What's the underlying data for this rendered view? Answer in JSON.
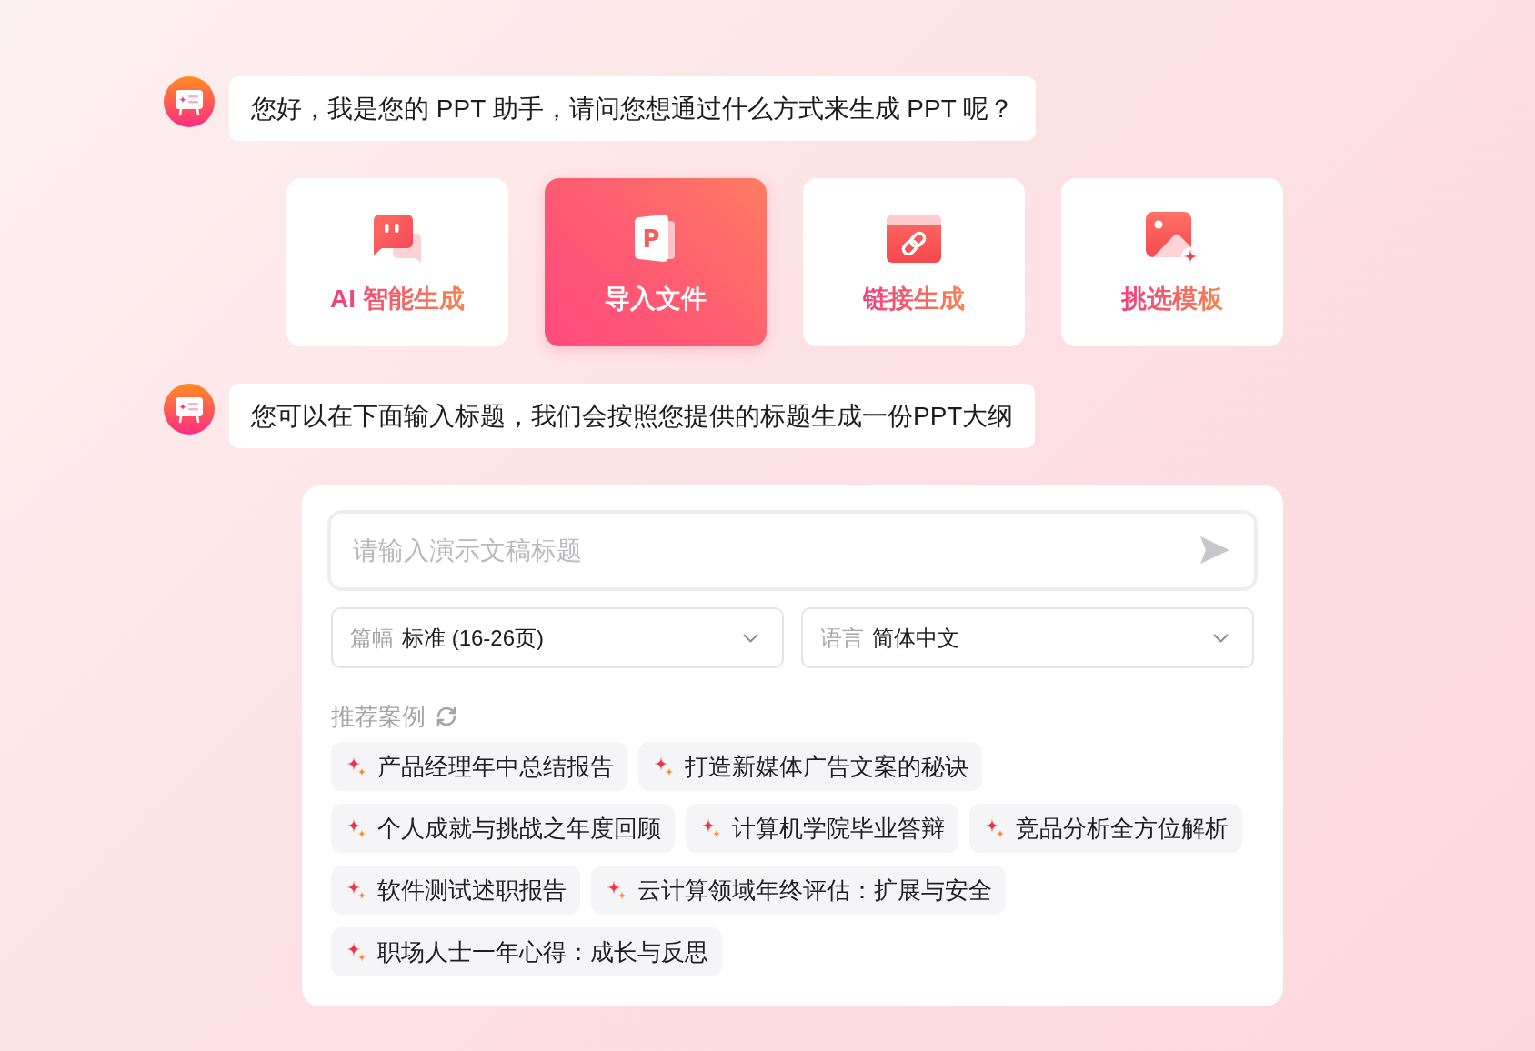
{
  "greeting": {
    "text": "您好，我是您的 PPT 助手，请问您想通过什么方式来生成 PPT 呢？"
  },
  "options": [
    {
      "label": "AI 智能生成",
      "selected": false
    },
    {
      "label": "导入文件",
      "selected": true,
      "icon_letter": "P"
    },
    {
      "label": "链接生成",
      "selected": false
    },
    {
      "label": "挑选模板",
      "selected": false
    }
  ],
  "prompt": {
    "text": "您可以在下面输入标题，我们会按照您提供的标题生成一份PPT大纲"
  },
  "composer": {
    "input": {
      "placeholder": "请输入演示文稿标题"
    },
    "selects": [
      {
        "label": "篇幅",
        "value": "标准 (16-26页)"
      },
      {
        "label": "语言",
        "value": "简体中文"
      }
    ],
    "suggestions": {
      "title": "推荐案例",
      "items": [
        "产品经理年中总结报告",
        "打造新媒体广告文案的秘诀",
        "个人成就与挑战之年度回顾",
        "计算机学院毕业答辩",
        "竞品分析全方位解析",
        "软件测试述职报告",
        "云计算领域年终评估：扩展与安全",
        "职场人士一年心得：成长与反思"
      ]
    }
  }
}
